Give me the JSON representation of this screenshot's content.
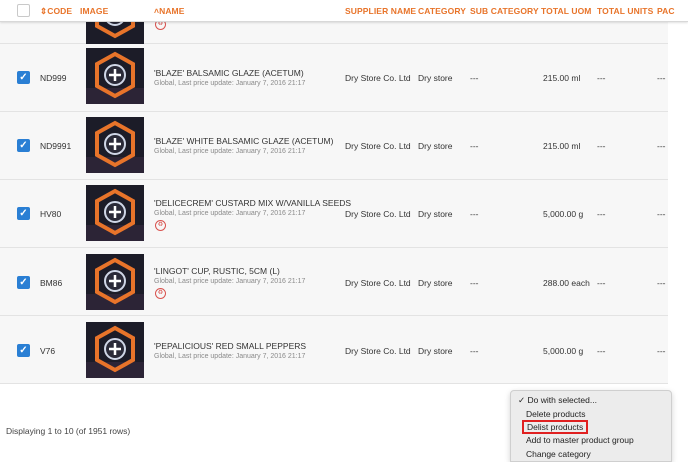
{
  "header": {
    "code": "CODE",
    "image": "IMAGE",
    "name": "NAME",
    "supplier_name": "SUPPLIER NAME",
    "category": "CATEGORY",
    "sub_category": "SUB CATEGORY",
    "total_uom": "TOTAL UOM",
    "total_units": "TOTAL UNITS",
    "pack": "PAC"
  },
  "rows": [
    {
      "code": "ND999",
      "name": "'BLAZE' BALSAMIC GLAZE (ACETUM)",
      "meta": "Global, Last price update: January 7, 2016 21:17",
      "supplier": "Dry Store Co. Ltd",
      "category": "Dry store",
      "sub_category": "---",
      "total_uom": "215.00 ml",
      "total_units": "---",
      "pack": "---",
      "has_delete": false
    },
    {
      "code": "ND9991",
      "name": "'BLAZE' WHITE BALSAMIC GLAZE (ACETUM)",
      "meta": "Global, Last price update: January 7, 2016 21:17",
      "supplier": "Dry Store Co. Ltd",
      "category": "Dry store",
      "sub_category": "---",
      "total_uom": "215.00 ml",
      "total_units": "---",
      "pack": "---",
      "has_delete": false
    },
    {
      "code": "HV80",
      "name": "'DELICECREM' CUSTARD MIX W/VANILLA SEEDS",
      "meta": "Global, Last price update: January 7, 2016 21:17",
      "supplier": "Dry Store Co. Ltd",
      "category": "Dry store",
      "sub_category": "---",
      "total_uom": "5,000.00 g",
      "total_units": "---",
      "pack": "---",
      "has_delete": true
    },
    {
      "code": "BM86",
      "name": "'LINGOT' CUP, RUSTIC, 5CM (L)",
      "meta": "Global, Last price update: January 7, 2016 21:17",
      "supplier": "Dry Store Co. Ltd",
      "category": "Dry store",
      "sub_category": "---",
      "total_uom": "288.00 each",
      "total_units": "---",
      "pack": "---",
      "has_delete": true
    },
    {
      "code": "V76",
      "name": "'PEPALICIOUS' RED SMALL PEPPERS",
      "meta": "Global, Last price update: January 7, 2016 21:17",
      "supplier": "Dry Store Co. Ltd",
      "category": "Dry store",
      "sub_category": "---",
      "total_uom": "5,000.00 g",
      "total_units": "---",
      "pack": "---",
      "has_delete": false
    }
  ],
  "footer": {
    "displaying": "Displaying 1 to 10 (of 1951 rows)"
  },
  "actions_menu": {
    "selected": "✓ Do with selected...",
    "options": [
      "Delete products",
      "Delist products",
      "Add to master product group",
      "Change category"
    ],
    "highlighted_index": 1
  },
  "colors": {
    "header_accent": "#e8742a",
    "checkbox": "#2a7fd4",
    "delete_icon": "#d9534f",
    "highlight_box": "#e02020"
  }
}
